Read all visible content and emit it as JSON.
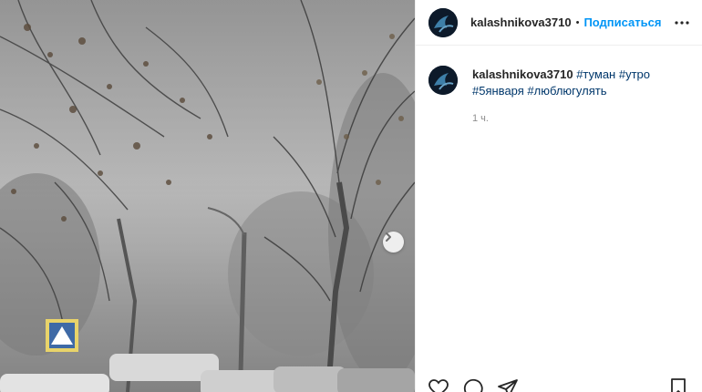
{
  "post": {
    "username": "kalashnikova3710",
    "separator": "•",
    "follow_label": "Подписаться",
    "caption": {
      "username": "kalashnikova3710",
      "hashtags": [
        "#туман",
        "#утро",
        "#5января",
        "#люблюгулять"
      ]
    },
    "time_ago": "1 ч."
  },
  "icons": {
    "more": "more-horizontal-icon",
    "next": "chevron-right-icon",
    "like": "heart-icon",
    "comment": "comment-icon",
    "share": "paper-plane-icon",
    "save": "bookmark-icon"
  },
  "colors": {
    "follow": "#0095f6",
    "hashtag": "#00376b",
    "muted": "#8e8e8e",
    "text": "#262626"
  }
}
